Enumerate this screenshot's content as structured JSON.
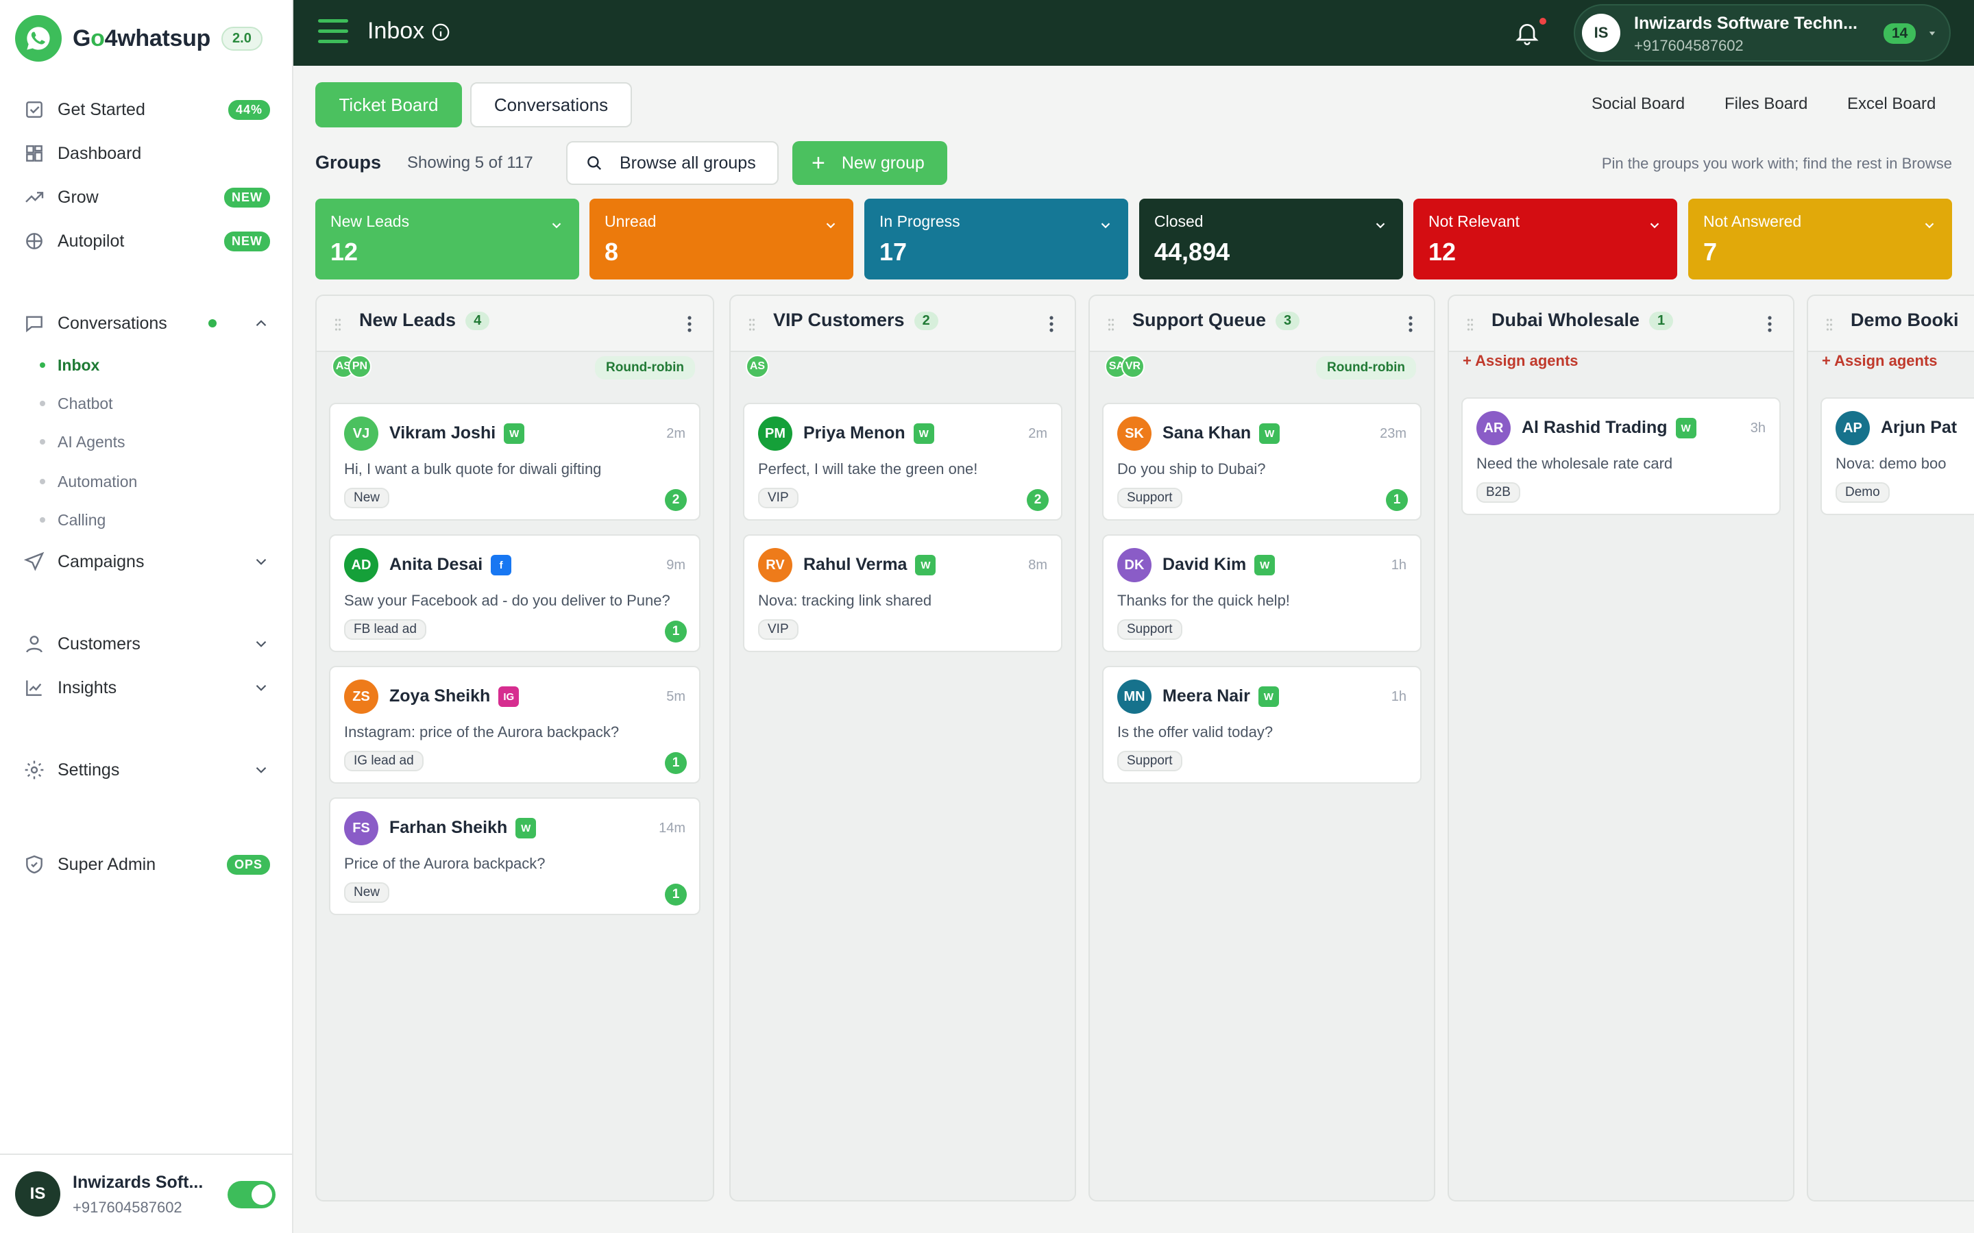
{
  "brand": {
    "name_pre": "G",
    "name_o": "o",
    "name_post": "4whatsup",
    "version": "2.0"
  },
  "sidebar": {
    "items": [
      {
        "label": "Get Started",
        "badge": "44%"
      },
      {
        "label": "Dashboard"
      },
      {
        "label": "Grow",
        "badge": "NEW"
      },
      {
        "label": "Autopilot",
        "badge": "NEW"
      },
      {
        "label": "Conversations"
      },
      {
        "label": "Campaigns"
      },
      {
        "label": "Customers"
      },
      {
        "label": "Insights"
      },
      {
        "label": "Settings"
      },
      {
        "label": "Super Admin",
        "badge": "OPS"
      }
    ],
    "sub_items": [
      "Inbox",
      "Chatbot",
      "AI Agents",
      "Automation",
      "Calling"
    ],
    "footer": {
      "initials": "IS",
      "name": "Inwizards Soft...",
      "phone": "+917604587602",
      "toggle_on": true
    }
  },
  "topbar": {
    "title": "Inbox",
    "account": {
      "initials": "IS",
      "name": "Inwizards Software Techn...",
      "phone": "+917604587602",
      "count": "14"
    }
  },
  "tabs": {
    "ticket_board": "Ticket Board",
    "conversations": "Conversations"
  },
  "links": {
    "social": "Social Board",
    "files": "Files Board",
    "excel": "Excel Board"
  },
  "groups": {
    "label": "Groups",
    "showing": "Showing 5 of 117",
    "browse": "Browse all groups",
    "new_group": "New group",
    "hint": "Pin the groups you work with; find the rest in Browse"
  },
  "stats": [
    {
      "label": "New Leads",
      "value": "12",
      "color": "#4bc15f"
    },
    {
      "label": "Unread",
      "value": "8",
      "color": "#ec7a0c"
    },
    {
      "label": "In Progress",
      "value": "17",
      "color": "#157896"
    },
    {
      "label": "Closed",
      "value": "44,894",
      "color": "#173527"
    },
    {
      "label": "Not Relevant",
      "value": "12",
      "color": "#d40d12"
    },
    {
      "label": "Not Answered",
      "value": "7",
      "color": "#e1a90a"
    }
  ],
  "columns": [
    {
      "title": "New Leads",
      "count": "4",
      "agents": [
        "AS",
        "PN"
      ],
      "mode": "Round-robin",
      "cards": [
        {
          "initials": "VJ",
          "name": "Vikram Joshi",
          "channel": "W",
          "time": "2m",
          "msg": "Hi, I want a bulk quote for diwali gifting",
          "tag": "New",
          "unread": "2",
          "color": "#4bc15f"
        },
        {
          "initials": "AD",
          "name": "Anita Desai",
          "channel": "f",
          "time": "9m",
          "msg": "Saw your Facebook ad - do you deliver to Pune?",
          "tag": "FB lead ad",
          "unread": "1",
          "color": "#15a039"
        },
        {
          "initials": "ZS",
          "name": "Zoya Sheikh",
          "channel": "IG",
          "time": "5m",
          "msg": "Instagram: price of the Aurora backpack?",
          "tag": "IG lead ad",
          "unread": "1",
          "color": "#ee7b1a"
        },
        {
          "initials": "FS",
          "name": "Farhan Sheikh",
          "channel": "W",
          "time": "14m",
          "msg": "Price of the Aurora backpack?",
          "tag": "New",
          "unread": "1",
          "color": "#8a5cc7"
        }
      ]
    },
    {
      "title": "VIP Customers",
      "count": "2",
      "agents": [
        "AS"
      ],
      "mode": "",
      "cards": [
        {
          "initials": "PM",
          "name": "Priya Menon",
          "channel": "W",
          "time": "2m",
          "msg": "Perfect, I will take the green one!",
          "tag": "VIP",
          "unread": "2",
          "color": "#15a039"
        },
        {
          "initials": "RV",
          "name": "Rahul Verma",
          "channel": "W",
          "time": "8m",
          "msg": "Nova: tracking link shared",
          "tag": "VIP",
          "unread": "",
          "color": "#ee7b1a"
        }
      ]
    },
    {
      "title": "Support Queue",
      "count": "3",
      "agents": [
        "SA",
        "VR"
      ],
      "mode": "Round-robin",
      "cards": [
        {
          "initials": "SK",
          "name": "Sana Khan",
          "channel": "W",
          "time": "23m",
          "msg": "Do you ship to Dubai?",
          "tag": "Support",
          "unread": "1",
          "color": "#ee7b1a"
        },
        {
          "initials": "DK",
          "name": "David Kim",
          "channel": "W",
          "time": "1h",
          "msg": "Thanks for the quick help!",
          "tag": "Support",
          "unread": "",
          "color": "#8a5cc7"
        },
        {
          "initials": "MN",
          "name": "Meera Nair",
          "channel": "W",
          "time": "1h",
          "msg": "Is the offer valid today?",
          "tag": "Support",
          "unread": "",
          "color": "#16728c"
        }
      ]
    },
    {
      "title": "Dubai Wholesale",
      "count": "1",
      "assign": "+ Assign agents",
      "cards": [
        {
          "initials": "AR",
          "name": "Al Rashid Trading",
          "channel": "W",
          "time": "3h",
          "msg": "Need the wholesale rate card",
          "tag": "B2B",
          "unread": "",
          "color": "#8a5cc7"
        }
      ]
    },
    {
      "title": "Demo Booki",
      "count": "",
      "assign": "+ Assign agents",
      "cards": [
        {
          "initials": "AP",
          "name": "Arjun Pat",
          "channel": "",
          "time": "",
          "msg": "Nova: demo boo",
          "tag": "Demo",
          "unread": "",
          "color": "#16728c"
        }
      ]
    }
  ]
}
